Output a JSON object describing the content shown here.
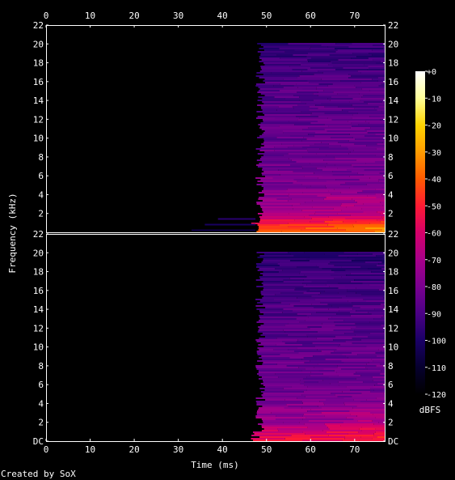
{
  "chart_data": {
    "type": "heatmap",
    "title": "",
    "xlabel": "Time (ms)",
    "ylabel": "Frequency (kHz)",
    "x_ticks": [
      0,
      10,
      20,
      30,
      40,
      50,
      60,
      70
    ],
    "xlim": [
      0,
      77
    ],
    "y_ticks": [
      "DC",
      "2",
      "4",
      "6",
      "8",
      "10",
      "12",
      "14",
      "16",
      "18",
      "20",
      "22"
    ],
    "y_ticks_top_channel": [
      "2",
      "4",
      "6",
      "8",
      "10",
      "12",
      "14",
      "16",
      "18",
      "20",
      "22"
    ],
    "ylim_khz": [
      0,
      22
    ],
    "channels": [
      {
        "channel": 1,
        "onset_ms": 47.5,
        "max_content_khz": 20,
        "energy_profile_db": [
          {
            "khz": 0.5,
            "db": -40
          },
          {
            "khz": 2,
            "db": -70
          },
          {
            "khz": 5,
            "db": -80
          },
          {
            "khz": 10,
            "db": -85
          },
          {
            "khz": 15,
            "db": -88
          },
          {
            "khz": 20,
            "db": -95
          }
        ],
        "pre_onset_low_freq_start_ms": 33
      },
      {
        "channel": 2,
        "onset_ms": 47.5,
        "max_content_khz": 20,
        "energy_profile_db": [
          {
            "khz": 0.5,
            "db": -55
          },
          {
            "khz": 2,
            "db": -72
          },
          {
            "khz": 5,
            "db": -82
          },
          {
            "khz": 10,
            "db": -86
          },
          {
            "khz": 15,
            "db": -90
          },
          {
            "khz": 20,
            "db": -97
          }
        ]
      }
    ],
    "colorbar": {
      "label": "dBFS",
      "ticks": [
        "+0",
        "-10",
        "-20",
        "-30",
        "-40",
        "-50",
        "-60",
        "-70",
        "-80",
        "-90",
        "-100",
        "-110",
        "-120"
      ],
      "range_db": [
        -120,
        0
      ],
      "colors": [
        "#000000",
        "#06002e",
        "#1a0066",
        "#4b0085",
        "#7a0090",
        "#a8008a",
        "#d6006a",
        "#ff1a33",
        "#ff5a00",
        "#ff9c00",
        "#ffd400",
        "#ffff99",
        "#ffffff"
      ]
    },
    "grid": false
  },
  "footer": {
    "credit": "Created by SoX"
  }
}
